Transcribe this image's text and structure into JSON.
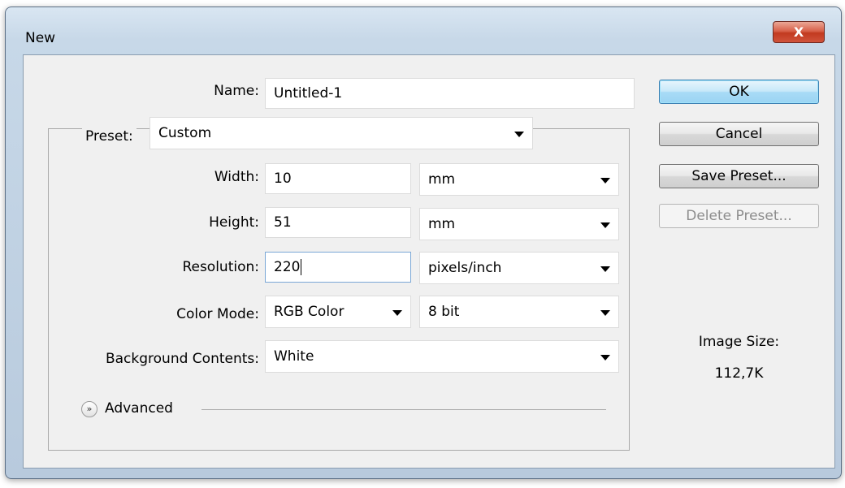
{
  "window": {
    "title": "New",
    "close_label": "X"
  },
  "form": {
    "name_label": "Name:",
    "name_value": "Untitled-1",
    "preset_label": "Preset:",
    "preset_value": "Custom",
    "width_label": "Width:",
    "width_value": "10",
    "width_unit": "mm",
    "height_label": "Height:",
    "height_value": "51",
    "height_unit": "mm",
    "resolution_label": "Resolution:",
    "resolution_value": "220",
    "resolution_unit": "pixels/inch",
    "color_mode_label": "Color Mode:",
    "color_mode_value": "RGB Color",
    "bit_depth_value": "8 bit",
    "background_label": "Background Contents:",
    "background_value": "White",
    "advanced_label": "Advanced"
  },
  "buttons": {
    "ok": "OK",
    "cancel": "Cancel",
    "save_preset": "Save Preset...",
    "delete_preset": "Delete Preset..."
  },
  "image_size": {
    "label": "Image Size:",
    "value": "112,7K"
  },
  "icons": {
    "close": "close-icon",
    "dropdown": "chevron-down-icon",
    "advanced": "double-chevron-down-icon"
  }
}
